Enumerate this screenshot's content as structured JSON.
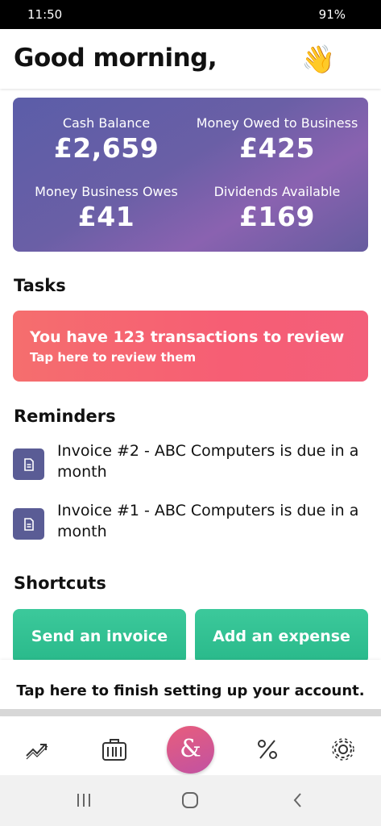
{
  "status_bar": {
    "time": "11:50",
    "battery": "91%"
  },
  "header": {
    "greeting": "Good morning,",
    "emoji": "👋"
  },
  "summary": {
    "cash_balance": {
      "label": "Cash Balance",
      "value": "£2,659"
    },
    "money_owed_to_business": {
      "label": "Money Owed to Business",
      "value": "£425"
    },
    "money_business_owes": {
      "label": "Money Business Owes",
      "value": "£41"
    },
    "dividends_available": {
      "label": "Dividends Available",
      "value": "£169"
    }
  },
  "tasks": {
    "title": "Tasks",
    "card": {
      "headline": "You have 123 transactions to review",
      "subtext": "Tap here to review them"
    }
  },
  "reminders": {
    "title": "Reminders",
    "items": [
      {
        "text": "Invoice #2 - ABC Computers is due in a month",
        "icon": "document-icon"
      },
      {
        "text": "Invoice #1 - ABC Computers is due in a month",
        "icon": "document-icon"
      }
    ]
  },
  "shortcuts": {
    "title": "Shortcuts",
    "send_invoice": "Send an invoice",
    "add_expense": "Add an expense"
  },
  "setup_bar": {
    "text": "Tap here to finish setting up your account."
  },
  "tab_bar": {
    "items": [
      {
        "icon": "trend-icon"
      },
      {
        "icon": "bank-icon"
      },
      {
        "icon": "ampersand-icon",
        "label": "&"
      },
      {
        "icon": "percent-icon"
      },
      {
        "icon": "gear-icon"
      }
    ]
  },
  "colors": {
    "summary_gradient": [
      "#5b5da8",
      "#8a62b0"
    ],
    "task_gradient": [
      "#f56e6e",
      "#f35f7a"
    ],
    "shortcut_green": "#2fbf8f",
    "reminder_icon_bg": "#5a5c95",
    "fab_gradient": [
      "#e85d7c",
      "#c152a2"
    ]
  }
}
